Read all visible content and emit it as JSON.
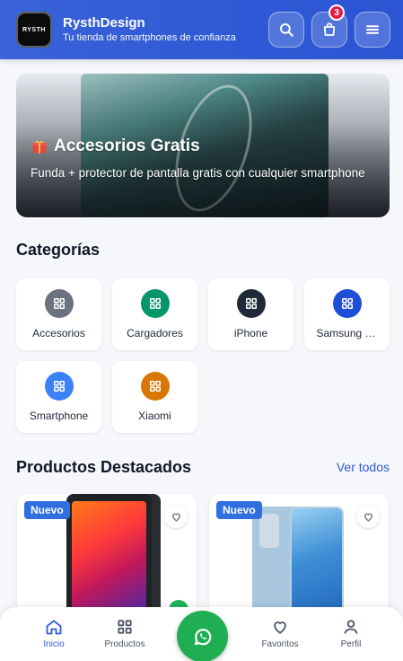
{
  "header": {
    "logo_text": "RYSTH",
    "brand_name": "RysthDesign",
    "tagline": "Tu tienda de smartphones de confianza",
    "cart_count": "3"
  },
  "hero": {
    "title": "Accesorios Gratis",
    "description": "Funda + protector de pantalla gratis con cualquier smartphone"
  },
  "categories": {
    "title": "Categorías",
    "items": [
      {
        "label": "Accesorios",
        "color": "#6b7280"
      },
      {
        "label": "Cargadores",
        "color": "#059669"
      },
      {
        "label": "iPhone",
        "color": "#1f2937"
      },
      {
        "label": "Samsung Galaxy",
        "color": "#1d4ed8"
      },
      {
        "label": "Smartphone",
        "color": "#3b82f6"
      },
      {
        "label": "Xiaomi",
        "color": "#d97706"
      }
    ]
  },
  "products": {
    "title": "Productos Destacados",
    "see_all": "Ver todos",
    "items": [
      {
        "badge": "Nuevo"
      },
      {
        "badge": "Nuevo"
      }
    ]
  },
  "nav": {
    "items": [
      {
        "label": "Inicio",
        "icon": "home-icon",
        "active": true
      },
      {
        "label": "Productos",
        "icon": "grid-icon",
        "active": false
      },
      {
        "label": "Favoritos",
        "icon": "heart-icon",
        "active": false
      },
      {
        "label": "Perfil",
        "icon": "user-icon",
        "active": false
      }
    ],
    "whatsapp_icon": "whatsapp-icon"
  },
  "colors": {
    "primary": "#2f59d6",
    "badge": "#e11d48",
    "whatsapp": "#1fae52"
  }
}
